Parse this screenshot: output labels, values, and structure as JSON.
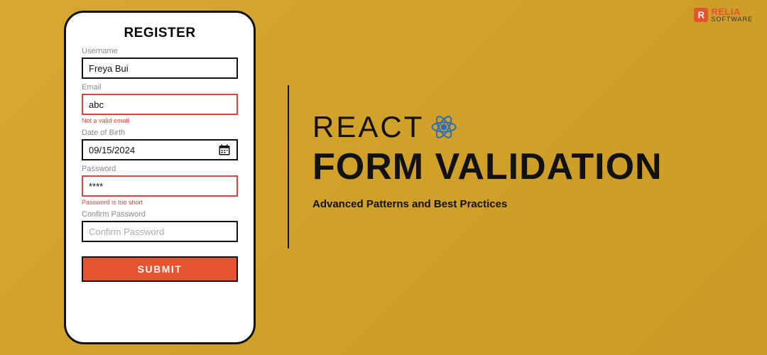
{
  "logo": {
    "top": "RELIA",
    "bottom": "SOFTWARE"
  },
  "card": {
    "title": "REGISTER",
    "username": {
      "label": "Username",
      "value": "Freya Bui"
    },
    "email": {
      "label": "Email",
      "value": "abc",
      "error": "Not a valid email"
    },
    "dob": {
      "label": "Date of Birth",
      "value": "09/15/2024"
    },
    "password": {
      "label": "Password",
      "value": "****",
      "error": "Password is too short"
    },
    "confirm": {
      "label": "Confirm Password",
      "placeholder": "Confirm Password"
    },
    "submit": "SUBMIT"
  },
  "headline": {
    "react": "REACT",
    "main": "FORM VALIDATION",
    "sub": "Advanced Patterns and Best Practices"
  }
}
